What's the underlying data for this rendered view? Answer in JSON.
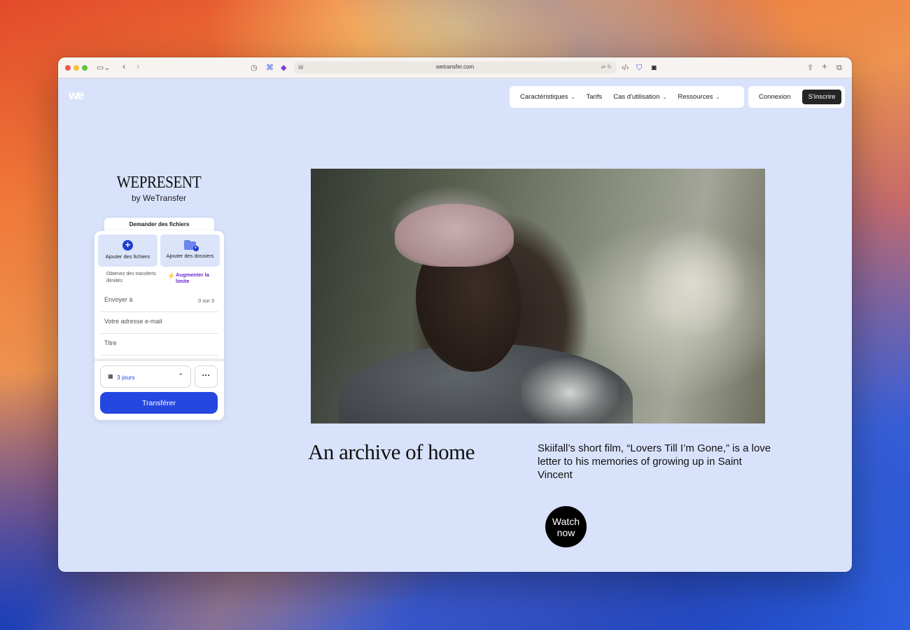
{
  "browser": {
    "url": "wetransfer.com"
  },
  "site": {
    "logo": "we"
  },
  "nav": {
    "items": [
      {
        "label": "Caractéristiques",
        "has_dropdown": true
      },
      {
        "label": "Tarifs",
        "has_dropdown": false
      },
      {
        "label": "Cas d'utilisation",
        "has_dropdown": true
      },
      {
        "label": "Ressources",
        "has_dropdown": true
      }
    ],
    "login": "Connexion",
    "signup": "S'inscrire"
  },
  "brand": {
    "title": "WEPRESENT",
    "subtitle": "by WeTransfer"
  },
  "transfer_widget": {
    "request_tab": "Demander des fichiers",
    "add_files": "Ajouter des fichiers",
    "add_folders": "Ajouter des dossiers",
    "promo": "Obtenez des transferts illimités",
    "upgrade": "Augmenter la limite",
    "recipient_placeholder": "Envoyer à",
    "recipient_count": "0 sur 3",
    "email_placeholder": "Votre adresse e-mail",
    "title_placeholder": "Titre",
    "expiry": "3 jours",
    "more": "···",
    "submit": "Transférer"
  },
  "hero": {
    "headline": "An archive of home",
    "description": "Skiifall’s short film, “Lovers Till I’m Gone,” is a love letter to his memories of growing up in Saint Vincent",
    "cta": "Watch now"
  },
  "colors": {
    "page_background": "#d8e2fb",
    "accent_blue": "#2447e0",
    "upgrade_purple": "#6a2ad0",
    "signup_bg": "#252525"
  }
}
